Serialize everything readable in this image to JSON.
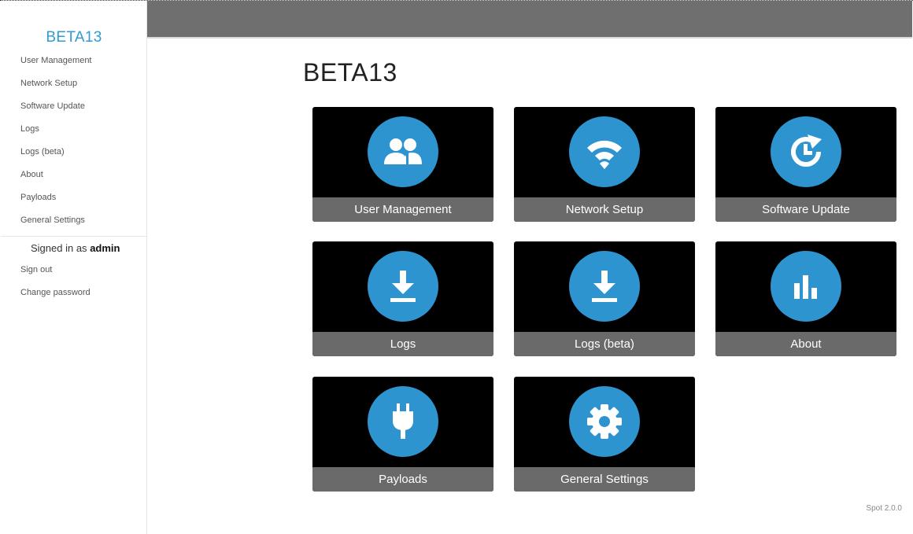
{
  "sidebar": {
    "brand": "BETA13",
    "items": [
      {
        "label": "User Management"
      },
      {
        "label": "Network Setup"
      },
      {
        "label": "Software Update"
      },
      {
        "label": "Logs"
      },
      {
        "label": "Logs (beta)"
      },
      {
        "label": "About"
      },
      {
        "label": "Payloads"
      },
      {
        "label": "General Settings"
      }
    ],
    "signed_in_prefix": "Signed in as",
    "signed_in_user": "admin",
    "account_items": [
      {
        "label": "Sign out"
      },
      {
        "label": "Change password"
      }
    ]
  },
  "main": {
    "title": "BETA13",
    "tiles": [
      {
        "label": "User Management",
        "icon": "users-icon"
      },
      {
        "label": "Network Setup",
        "icon": "wifi-icon"
      },
      {
        "label": "Software Update",
        "icon": "update-clock-icon"
      },
      {
        "label": "Logs",
        "icon": "download-icon"
      },
      {
        "label": "Logs (beta)",
        "icon": "download-icon"
      },
      {
        "label": "About",
        "icon": "bar-chart-icon"
      },
      {
        "label": "Payloads",
        "icon": "plug-icon"
      },
      {
        "label": "General Settings",
        "icon": "gear-icon"
      }
    ],
    "version": "Spot 2.0.0"
  },
  "colors": {
    "accent": "#2e9ad6",
    "topbar": "#6f6f6f",
    "tile_bg": "#000000",
    "tile_label_bg": "#6a6a6a"
  }
}
